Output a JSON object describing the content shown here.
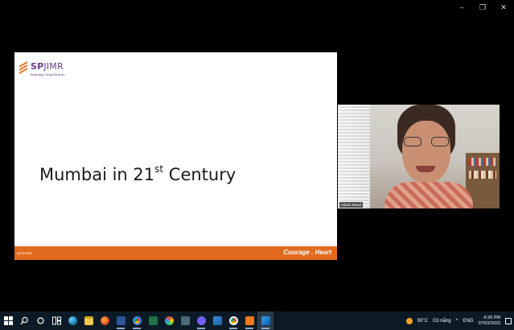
{
  "window_controls": {
    "minimize": "–",
    "restore": "❐",
    "close": "✕"
  },
  "slide": {
    "logo": {
      "brand_bold": "SP",
      "brand_rest": "JIMR",
      "tagline": "Bharatiya Vidya Bhavan"
    },
    "title_main": "Mumbai in 21",
    "title_sup": "st",
    "title_end": " Century",
    "footer_left": "@SPJIMR",
    "footer_right": "Courage . Heart",
    "accent_color": "#e26a1e",
    "brand_color": "#6b3a8c"
  },
  "video": {
    "participant_name": "Aslam Mood"
  },
  "taskbar": {
    "icons": [
      "windows-start",
      "search",
      "task-view",
      "widgets",
      "edge",
      "file-explorer",
      "firefox",
      "word",
      "chrome",
      "excel",
      "paint",
      "calculator",
      "viber",
      "photos",
      "chrome-alt",
      "app",
      "remote-desktop"
    ],
    "tray": {
      "temperature": "30°C",
      "weather_text": "Cô nắng",
      "chevron": "^",
      "language": "ENG",
      "time": "6:26 PM",
      "date": "07/03/2023"
    }
  }
}
